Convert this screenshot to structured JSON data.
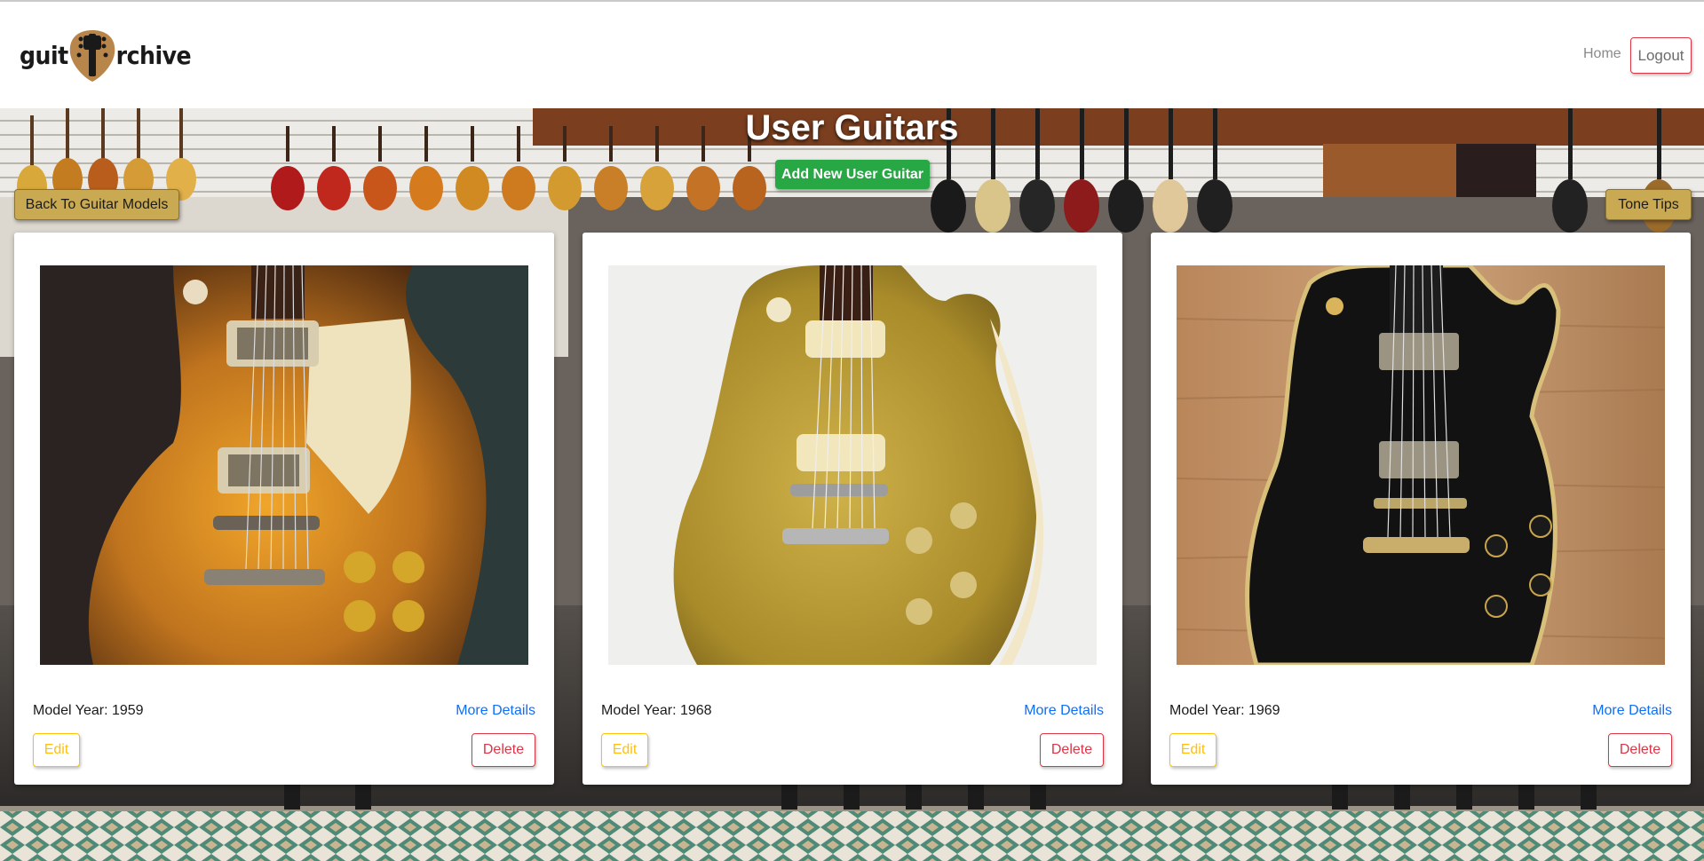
{
  "brand": {
    "logo_left": "guit",
    "logo_right": "rchive"
  },
  "nav": {
    "home_label": "Home",
    "logout_label": "Logout"
  },
  "page": {
    "title": "User Guitars",
    "add_label": "Add New User Guitar",
    "back_label": "Back To Guitar Models",
    "tone_label": "Tone Tips"
  },
  "cards": [
    {
      "year_text": "Model Year: 1959",
      "more_label": "More Details",
      "edit_label": "Edit",
      "delete_label": "Delete",
      "finish": "sunburst"
    },
    {
      "year_text": "Model Year: 1968",
      "more_label": "More Details",
      "edit_label": "Edit",
      "delete_label": "Delete",
      "finish": "goldtop"
    },
    {
      "year_text": "Model Year: 1969",
      "more_label": "More Details",
      "edit_label": "Edit",
      "delete_label": "Delete",
      "finish": "black"
    }
  ],
  "colors": {
    "add_button": "#28a745",
    "gold_button": "#c9a951",
    "edit": "#ffc107",
    "delete": "#dc3545",
    "link": "#0d6efd"
  }
}
